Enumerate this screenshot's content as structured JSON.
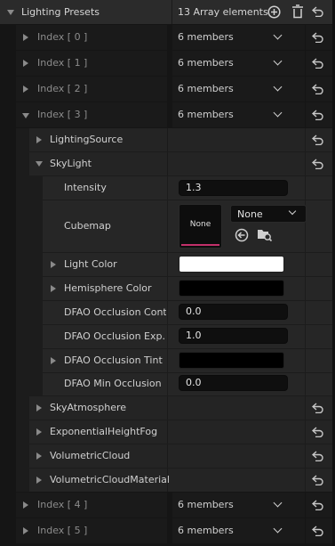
{
  "header": {
    "title": "Lighting Presets",
    "count_text": "13 Array elements"
  },
  "array_items": {
    "index0": {
      "label": "Index [ 0 ]",
      "members": "6 members"
    },
    "index1": {
      "label": "Index [ 1 ]",
      "members": "6 members"
    },
    "index2": {
      "label": "Index [ 2 ]",
      "members": "6 members"
    },
    "index3": {
      "label": "Index [ 3 ]",
      "members": "6 members"
    },
    "index4": {
      "label": "Index [ 4 ]",
      "members": "6 members"
    },
    "index5": {
      "label": "Index [ 5 ]",
      "members": "6 members"
    }
  },
  "index3_children": {
    "lighting_source": "LightingSource",
    "sky_light": "SkyLight",
    "sky_atmosphere": "SkyAtmosphere",
    "exponential_height_fog": "ExponentialHeightFog",
    "volumetric_cloud": "VolumetricCloud",
    "volumetric_cloud_material": "VolumetricCloudMaterial"
  },
  "skylight": {
    "intensity_label": "Intensity",
    "intensity_value": "1.3",
    "cubemap_label": "Cubemap",
    "cubemap_thumb_text": "None",
    "cubemap_select": "None",
    "light_color_label": "Light Color",
    "light_color": "#ffffff",
    "hemisphere_color_label": "Hemisphere Color",
    "hemisphere_color": "#000000",
    "dfao_contrast_label": "DFAO Occlusion Cont...",
    "dfao_contrast_value": "0.0",
    "dfao_exponent_label": "DFAO Occlusion Exp...",
    "dfao_exponent_value": "1.0",
    "dfao_tint_label": "DFAO Occlusion Tint",
    "dfao_tint": "#000000",
    "dfao_min_label": "DFAO Min Occlusion",
    "dfao_min_value": "0.0"
  },
  "colors": {
    "accent_pink": "#c2306a"
  }
}
